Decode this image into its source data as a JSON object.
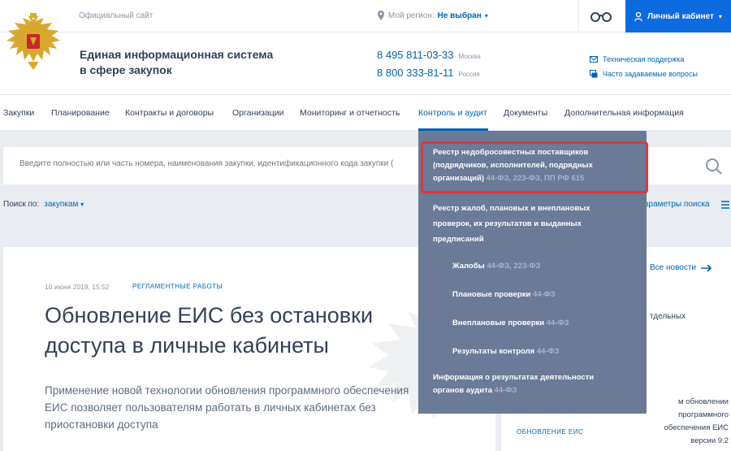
{
  "topbar": {
    "official": "Официальный сайт",
    "region_label": "Мой регион:",
    "region_value": "Не выбран",
    "cabinet": "Личный кабинет"
  },
  "header": {
    "system_name_1": "Единая информационная система",
    "system_name_2": "в сфере закупок",
    "phones": [
      {
        "number": "8 495 811-03-33",
        "city": "Москва"
      },
      {
        "number": "8 800 333-81-11",
        "city": "Россия"
      }
    ],
    "support": "Техническая поддержка",
    "faq": "Часто задаваемые вопросы"
  },
  "nav": {
    "items": [
      "Закупки",
      "Планирование",
      "Контракты и договоры",
      "Организации",
      "Мониторинг и отчетность",
      "Контроль и аудит",
      "Документы",
      "Дополнительная информация"
    ],
    "active": "Контроль и аудит"
  },
  "search": {
    "placeholder": "Введите полностью или часть номера, наименования закупки, идентификационного кода закупки (",
    "by_label": "Поиск по:",
    "by_value": "закупкам",
    "params": "араметры поиска"
  },
  "news": {
    "date": "10 июня 2019, 15:52",
    "tag": "РЕГЛАМЕНТНЫЕ РАБОТЫ",
    "title": "Обновление ЕИС без остановки доступа в личные кабинеты",
    "text": "Применение новой технологии обновления программного обеспечения ЕИС позволяет пользователям работать в личных кабинетах без приостановки доступа"
  },
  "side": {
    "all_news": "Все новости",
    "snip1": "тдельных",
    "snip2": "м обновлении программного обеспечения ЕИС версии 9.2",
    "tag": "ОБНОВЛЕНИЕ ЕИС"
  },
  "dropdown": {
    "item1_text": "Реестр недобросовестных поставщиков (подрядчиков, исполнителей, подрядных организаций)",
    "item1_law": "44-ФЗ, 223-ФЗ, ПП РФ 615",
    "item2_text": "Реестр жалоб, плановых и внеплановых проверок, их результатов и выданных предписаний",
    "sub": [
      {
        "text": "Жалобы",
        "law": "44-ФЗ, 223-ФЗ"
      },
      {
        "text": "Плановые проверки",
        "law": "44-ФЗ"
      },
      {
        "text": "Внеплановые проверки",
        "law": "44-ФЗ"
      },
      {
        "text": "Результаты контроля",
        "law": "44-ФЗ"
      }
    ],
    "item3_text": "Информация о результатах деятельности органов аудита",
    "item3_law": "44-ФЗ"
  }
}
